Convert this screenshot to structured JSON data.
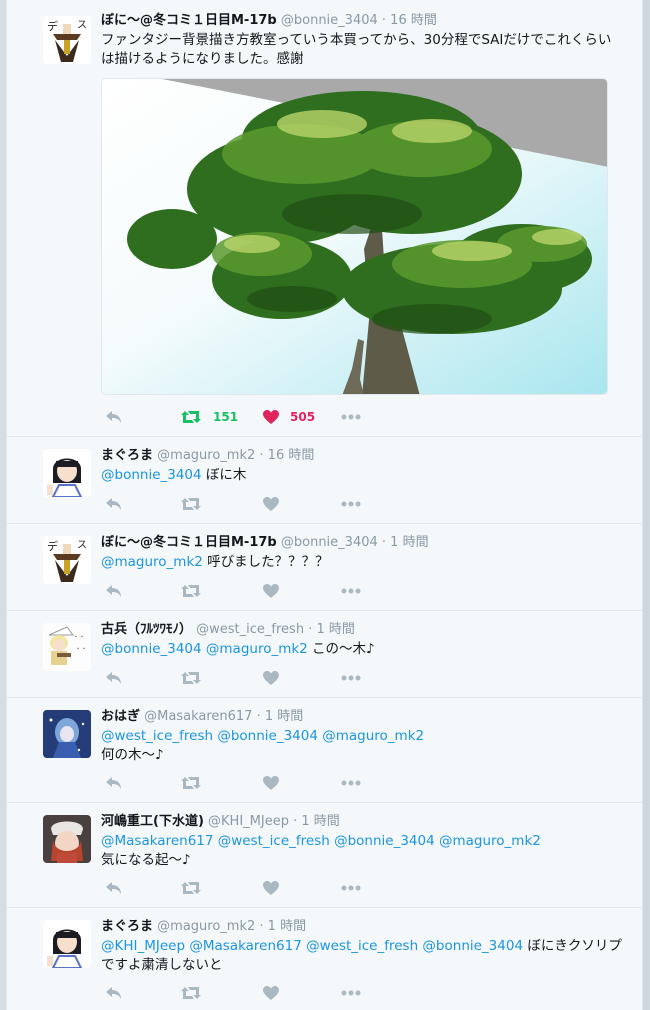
{
  "tweets": [
    {
      "name": "ぼに～@冬コミ１日目M-17b",
      "handle": "@bonnie_3404",
      "time": "16 時間",
      "text": "ファンタジー背景描き方教室っていう本買ってから、30分程でSAIだけでこれくらいは描けるようになりました。感謝",
      "retweets": "151",
      "likes": "505"
    },
    {
      "name": "まぐろま",
      "handle": "@maguro_mk2",
      "time": "16 時間",
      "mentions": "@bonnie_3404",
      "text": " ぼに木"
    },
    {
      "name": "ぼに～@冬コミ１日目M-17b",
      "handle": "@bonnie_3404",
      "time": "1 時間",
      "mentions": "@maguro_mk2",
      "text": " 呼びました？？？？"
    },
    {
      "name": "古兵（ﾌﾙﾂﾜﾓﾉ）",
      "handle": "@west_ice_fresh",
      "time": "1 時間",
      "mentions": "@bonnie_3404 @maguro_mk2",
      "text": " この～木♪"
    },
    {
      "name": "おはぎ",
      "handle": "@Masakaren617",
      "time": "1 時間",
      "mentions": "@west_ice_fresh @bonnie_3404 @maguro_mk2",
      "text": "何の木～♪"
    },
    {
      "name": "河嶋重工(下水道)",
      "handle": "@KHI_MJeep",
      "time": "1 時間",
      "mentions": "@Masakaren617 @west_ice_fresh @bonnie_3404 @maguro_mk2",
      "text": "気になる起～♪"
    },
    {
      "name": "まぐろま",
      "handle": "@maguro_mk2",
      "time": "1 時間",
      "mentions": "@KHI_MJeep @Masakaren617 @west_ice_fresh @bonnie_3404",
      "text": " ぼにきクソリプですよ粛清しないと"
    }
  ],
  "time_sep": " · ",
  "colors": {
    "retweet_green": "#17bf63",
    "like_red": "#e0245e",
    "mention_blue": "#1b95e0",
    "action_gray": "#aab8c2"
  },
  "icons": [
    "reply-icon",
    "retweet-icon",
    "like-icon",
    "more-icon"
  ]
}
